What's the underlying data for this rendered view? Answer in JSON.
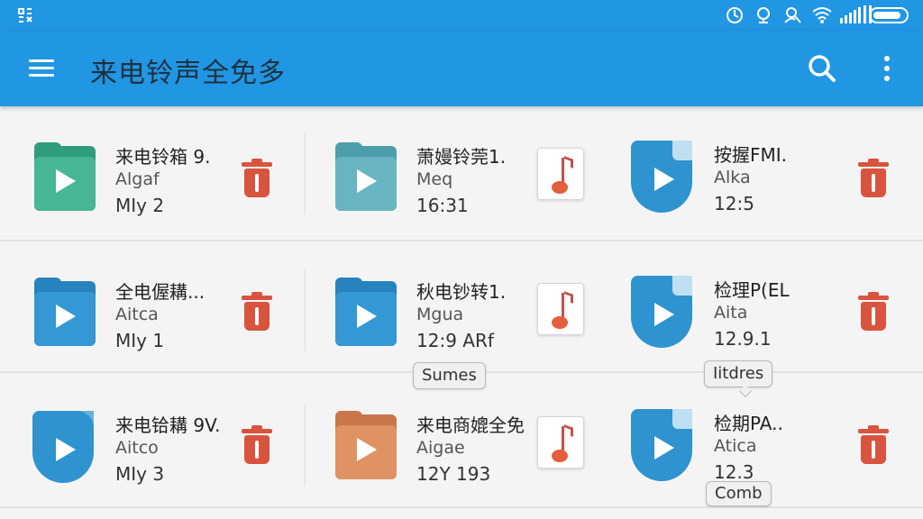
{
  "status_bar": {
    "left_icon": "usb-debug-icon",
    "right_icons": [
      "sync-icon",
      "alarm-icon",
      "person-icon",
      "wifi-icon",
      "signal-icon",
      "battery-icon"
    ]
  },
  "app_bar": {
    "title": "来电铃声全免多",
    "menu_icon": "hamburger-menu-icon",
    "search_icon": "search-icon",
    "more_icon": "more-vert-icon"
  },
  "colors": {
    "primary": "#2196e3",
    "delete": "#d9543e",
    "folder_green": "#3aa888",
    "folder_teal": "#5aaab7",
    "folder_blue": "#2f93cf",
    "folder_orange": "#d8895a"
  },
  "files": [
    {
      "name": "来电铃箱 9.",
      "artist": "Algaf",
      "meta": "MIy 2",
      "icon": "folder-green",
      "action": "delete"
    },
    {
      "name": "萧嫚铃莞1.",
      "artist": "Meq",
      "meta": "16:31",
      "icon": "folder-teal",
      "action": "music"
    },
    {
      "name": "按握FMI.",
      "artist": "Alka",
      "meta": "12:5",
      "icon": "doc-blue",
      "action": "delete"
    },
    {
      "name": "全电偓耩...",
      "artist": "Aitca",
      "meta": "MIy 1",
      "icon": "folder-blue",
      "action": "delete"
    },
    {
      "name": "秋电钞转1.",
      "artist": "Mgua",
      "meta": "12:9 ARf",
      "icon": "folder-blue",
      "action": "music"
    },
    {
      "name": "检理P(EL",
      "artist": "Aita",
      "meta": "12.9.1",
      "icon": "doc-blue",
      "action": "delete"
    },
    {
      "name": "来电铪耩 9V.",
      "artist": "Aitco",
      "meta": "MIy 3",
      "icon": "doc-blue",
      "action": "delete"
    },
    {
      "name": "来电商媲全免",
      "artist": "Aigae",
      "meta": "12Y 193",
      "icon": "folder-orange",
      "action": "music"
    },
    {
      "name": "检期PA..",
      "artist": "Atica",
      "meta": "12.3",
      "icon": "doc-blue",
      "action": "delete"
    }
  ],
  "chips": {
    "chip1": "Sumes",
    "chip2": "Iitdres",
    "chip3": "Comb"
  }
}
